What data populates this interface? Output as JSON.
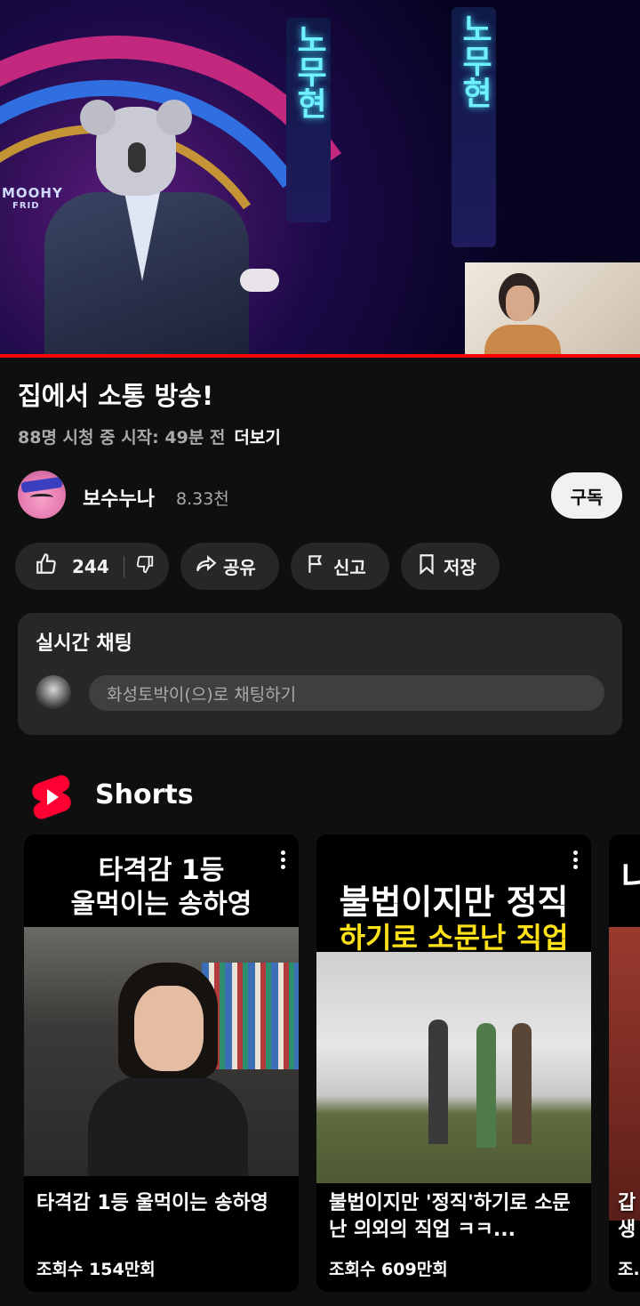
{
  "video": {
    "title": "집에서 소통 방송!",
    "meta": "88명 시청 중  시작: 49분 전",
    "more": "더보기",
    "progress_percent": 100,
    "stage_sign": "MOOHY",
    "stage_sign_sub": "FRID",
    "led_text_1": "노무현",
    "led_text_2": "노무현"
  },
  "channel": {
    "name": "보수누나",
    "subscribers": "8.33천",
    "subscribe_label": "구독"
  },
  "actions": {
    "like_count": "244",
    "share_label": "공유",
    "report_label": "신고",
    "save_label": "저장"
  },
  "live_chat": {
    "title": "실시간 채팅",
    "placeholder": "화성토박이(으)로 채팅하기"
  },
  "shorts": {
    "heading": "Shorts",
    "items": [
      {
        "headline": "타격감 1등\n울먹이는 송하영",
        "caption": "타격감 1등 울먹이는 송하영",
        "views": "조회수 154만회"
      },
      {
        "headline_line1": "불법이지만 정직",
        "headline_line2": "하기로 소문난 직업",
        "caption": "불법이지만 '정직'하기로 소문난 의외의 직업 ㅋㅋ...",
        "views": "조회수 609만회"
      },
      {
        "headline": "나",
        "caption": "갑\n생",
        "views": "조."
      }
    ]
  },
  "colors": {
    "background": "#0f0f0f",
    "pill": "#272727",
    "accent_red": "#ff0000",
    "yellow_text": "#ffe11a"
  }
}
